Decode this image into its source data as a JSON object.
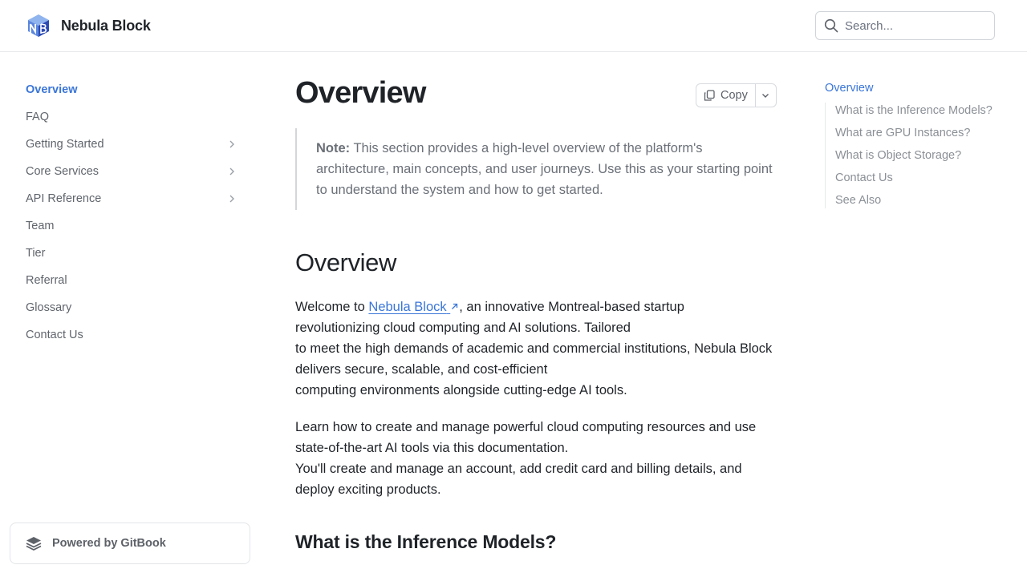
{
  "header": {
    "brand_name": "Nebula Block",
    "search_placeholder": "Search..."
  },
  "sidebar": {
    "items": [
      {
        "label": "Overview",
        "active": true,
        "expandable": false
      },
      {
        "label": "FAQ",
        "active": false,
        "expandable": false
      },
      {
        "label": "Getting Started",
        "active": false,
        "expandable": true
      },
      {
        "label": "Core Services",
        "active": false,
        "expandable": true
      },
      {
        "label": "API Reference",
        "active": false,
        "expandable": true
      },
      {
        "label": "Team",
        "active": false,
        "expandable": false
      },
      {
        "label": "Tier",
        "active": false,
        "expandable": false
      },
      {
        "label": "Referral",
        "active": false,
        "expandable": false
      },
      {
        "label": "Glossary",
        "active": false,
        "expandable": false
      },
      {
        "label": "Contact Us",
        "active": false,
        "expandable": false
      }
    ],
    "powered_by": "Powered by GitBook"
  },
  "main": {
    "title": "Overview",
    "copy_label": "Copy",
    "note_label": "Note:",
    "note_text": " This section provides a high-level overview of the platform's architecture, main concepts, and user journeys. Use this as your starting point to understand the system and how to get started.",
    "section_heading": "Overview",
    "para1_prefix": "Welcome to ",
    "para1_link": "Nebula Block",
    "para1_line1_rest": ", an innovative Montreal-based startup",
    "para1_line2": "revolutionizing cloud computing and AI solutions. Tailored",
    "para1_line3": "to meet the high demands of academic and commercial institutions, Nebula Block delivers secure, scalable, and cost-efficient",
    "para1_line4": "computing environments alongside cutting-edge AI tools.",
    "para2_line1": "Learn how to create and manage powerful cloud computing resources and use state-of-the-art AI tools via this documentation.",
    "para2_line2": "You'll create and manage an account, add credit card and billing details, and deploy exciting products.",
    "subheading": "What is the Inference Models?"
  },
  "toc": {
    "top": "Overview",
    "items": [
      "What is the Inference Models?",
      "What are GPU Instances?",
      "What is Object Storage?",
      "Contact Us",
      "See Also"
    ]
  },
  "colors": {
    "accent": "#3a76d8",
    "logo_dark": "#2b4bb3",
    "logo_light": "#7fa6ea"
  },
  "icons": {
    "brand": "nebula-cube-logo-icon",
    "search": "search-icon",
    "chevron": "chevron-right-icon",
    "copy": "copy-icon",
    "dropdown": "chevron-down-icon",
    "external": "external-link-icon",
    "gitbook": "gitbook-icon"
  }
}
